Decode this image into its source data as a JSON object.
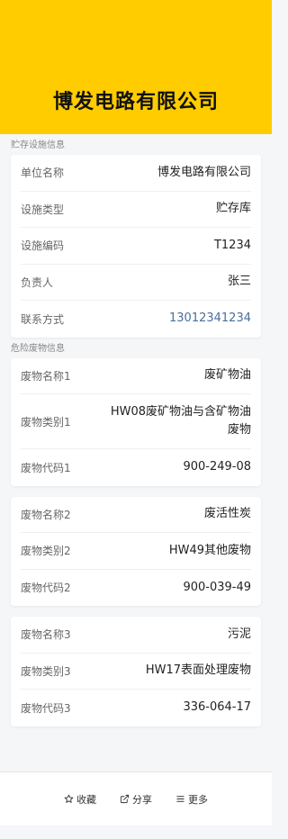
{
  "header": {
    "title": "博发电路有限公司"
  },
  "storage_section": {
    "title": "贮存设施信息",
    "rows": [
      {
        "label": "单位名称",
        "value": "博发电路有限公司"
      },
      {
        "label": "设施类型",
        "value": "贮存库"
      },
      {
        "label": "设施编码",
        "value": "T1234"
      },
      {
        "label": "负责人",
        "value": "张三"
      },
      {
        "label": "联系方式",
        "value": "13012341234"
      }
    ]
  },
  "waste_section": {
    "title": "危险废物信息",
    "cards": [
      {
        "rows": [
          {
            "label": "废物名称1",
            "value": "废矿物油"
          },
          {
            "label": "废物类别1",
            "value": "HW08废矿物油与含矿物油废物"
          },
          {
            "label": "废物代码1",
            "value": "900-249-08"
          }
        ]
      },
      {
        "rows": [
          {
            "label": "废物名称2",
            "value": "废活性炭"
          },
          {
            "label": "废物类别2",
            "value": "HW49其他废物"
          },
          {
            "label": "废物代码2",
            "value": "900-039-49"
          }
        ]
      },
      {
        "rows": [
          {
            "label": "废物名称3",
            "value": "污泥"
          },
          {
            "label": "废物类别3",
            "value": "HW17表面处理废物"
          },
          {
            "label": "废物代码3",
            "value": "336-064-17"
          }
        ]
      }
    ]
  },
  "bottom_bar": {
    "favorite_label": "收藏",
    "share_label": "分享",
    "more_label": "更多",
    "favorite_icon": "star-outline-icon",
    "share_icon": "share-icon",
    "more_icon": "menu-icon"
  },
  "colors": {
    "header_bg": "#ffcc00",
    "link": "#4a6f9a"
  }
}
